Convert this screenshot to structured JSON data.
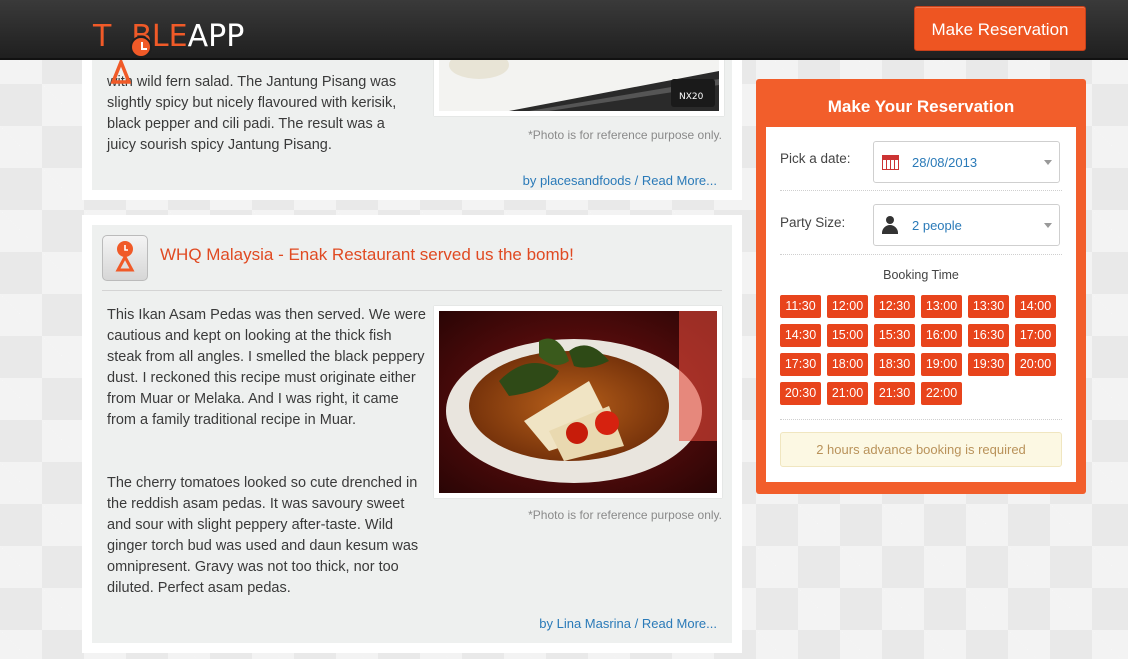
{
  "header": {
    "logo_text_1": "T",
    "logo_text_2": "BLE",
    "logo_text_3": "APP",
    "reserve_button": "Make Reservation"
  },
  "article1": {
    "text": "with wild fern salad. The Jantung Pisang was slightly spicy but nicely flavoured with kerisik, black pepper and cili padi. The result was a juicy sourish spicy Jantung Pisang.",
    "photo_note": "*Photo is for reference purpose only.",
    "byline": "by placesandfoods / Read More..."
  },
  "article2": {
    "title": "WHQ Malaysia - Enak Restaurant served us the bomb!",
    "paragraph1": "This Ikan Asam Pedas was then served. We were cautious and kept on looking at the thick fish steak from all angles. I smelled the black peppery dust. I reckoned this recipe must originate either from Muar or Melaka. And I was right, it came from a family traditional recipe in Muar.",
    "paragraph2": "The cherry tomatoes looked so cute drenched in the reddish asam pedas. It was savoury sweet and sour with slight peppery after-taste. Wild ginger torch bud was used and daun kesum was omnipresent. Gravy was not too thick, nor too diluted. Perfect asam pedas.",
    "photo_note": "*Photo is for reference purpose only.",
    "byline": "by Lina Masrina / Read More..."
  },
  "reservation": {
    "title": "Make Your Reservation",
    "date_label": "Pick a date:",
    "date_value": "28/08/2013",
    "party_label": "Party Size:",
    "party_value": "2 people",
    "booking_time_label": "Booking Time",
    "slots": [
      "11:30",
      "12:00",
      "12:30",
      "13:00",
      "13:30",
      "14:00",
      "14:30",
      "15:00",
      "15:30",
      "16:00",
      "16:30",
      "17:00",
      "17:30",
      "18:00",
      "18:30",
      "19:00",
      "19:30",
      "20:00",
      "20:30",
      "21:00",
      "21:30",
      "22:00"
    ],
    "notice": "2 hours advance booking is required"
  },
  "colors": {
    "accent": "#f25e2b",
    "slot": "#e8441c",
    "link": "#2a7ab8"
  }
}
